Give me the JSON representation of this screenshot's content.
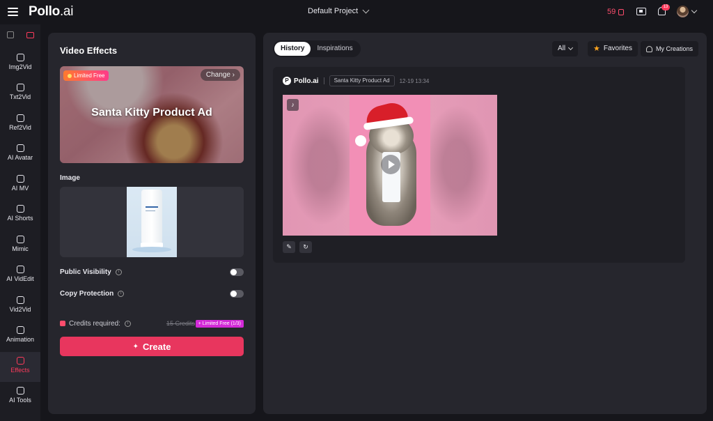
{
  "app": {
    "logo_main": "Pollo",
    "logo_suffix": ".ai"
  },
  "topbar": {
    "project": "Default Project",
    "credits": "59",
    "notifications_count": "13"
  },
  "sidebar": {
    "items": [
      {
        "label": "Img2Vid"
      },
      {
        "label": "Txt2Vid"
      },
      {
        "label": "Ref2Vid"
      },
      {
        "label": "AI Avatar"
      },
      {
        "label": "AI MV"
      },
      {
        "label": "AI Shorts"
      },
      {
        "label": "Mimic"
      },
      {
        "label": "AI VidEdit"
      },
      {
        "label": "Vid2Vid"
      },
      {
        "label": "Animation"
      },
      {
        "label": "Effects"
      },
      {
        "label": "AI Tools"
      }
    ],
    "active": "Effects"
  },
  "panel": {
    "title": "Video Effects",
    "effect": {
      "tag": "Limited Free",
      "change": "Change",
      "name": "Santa Kitty Product Ad"
    },
    "image_label": "Image",
    "public_visibility": "Public Visibility",
    "copy_protection": "Copy Protection",
    "credits_label": "Credits required:",
    "credits_old": "15 Credits",
    "credits_free": "+ Limited Free (1/3)",
    "create": "Create"
  },
  "right": {
    "tabs": [
      {
        "label": "History"
      },
      {
        "label": "Inspirations"
      }
    ],
    "filter_all": "All",
    "favorites": "Favorites",
    "my_creations": "My Creations",
    "card": {
      "brand": "Pollo.ai",
      "tag": "Santa Kitty Product Ad",
      "time": "12-19 13:34"
    }
  },
  "colors": {
    "accent": "#e8365e",
    "badge": "#d42ad8",
    "favorite": "#ffa51f"
  }
}
